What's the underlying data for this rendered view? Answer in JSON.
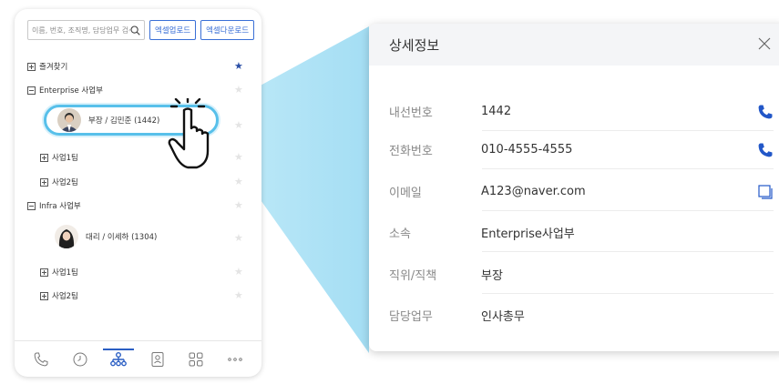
{
  "panel": {
    "search": {
      "placeholder": "이름, 번호, 조직명, 담당업무 검색"
    },
    "buttons": {
      "excel_upload": "엑셀업로드",
      "excel_download": "엑셀다운로드"
    },
    "tree": {
      "favorites": "즐겨찾기",
      "enterprise": "Enterprise 사업부",
      "enterprise_person": "부장 / 김민준 (1442)",
      "ent_team1": "사업1팀",
      "ent_team2": "사업2팀",
      "infra": "Infra 사업부",
      "infra_person": "대리 / 이세하 (1304)",
      "infra_team1": "사업1팀",
      "infra_team2": "사업2팀"
    },
    "tabbar": {
      "active_tab": "organization",
      "icons": [
        "phone-icon",
        "clock-icon",
        "organization-icon",
        "contacts-icon",
        "grid-icon",
        "more-icon"
      ]
    },
    "accent_color": "#2b4fa6",
    "highlight_color": "#58c0ea"
  },
  "detail": {
    "title": "상세정보",
    "rows": [
      {
        "label": "내선번호",
        "value": "1442"
      },
      {
        "label": "전화번호",
        "value": "010-4555-4555"
      },
      {
        "label": "이메일",
        "value": "A123@naver.com"
      },
      {
        "label": "소속",
        "value": "Enterprise사업부"
      },
      {
        "label": "직위/직책",
        "value": "부장"
      },
      {
        "label": "담당업무",
        "value": "인사총무"
      }
    ]
  }
}
